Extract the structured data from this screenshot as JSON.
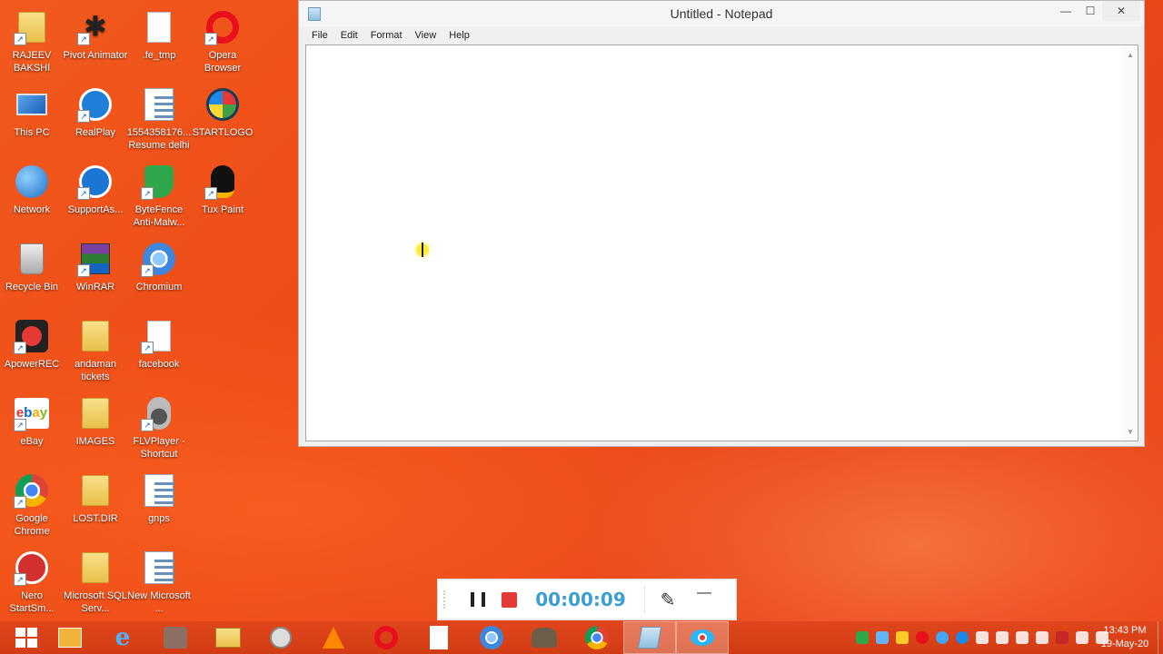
{
  "desktop": {
    "icons": [
      {
        "label": "RAJEEV BAKSHI",
        "icon": "folder-icon"
      },
      {
        "label": "Pivot Animator",
        "icon": "stick-figure-icon"
      },
      {
        "label": ".fe_tmp",
        "icon": "file-icon"
      },
      {
        "label": "Opera Browser",
        "icon": "opera-icon"
      },
      {
        "label": "This PC",
        "icon": "computer-icon"
      },
      {
        "label": "RealPlay",
        "icon": "realplay-icon"
      },
      {
        "label": "1554358176... Resume delhi",
        "icon": "word-document-icon"
      },
      {
        "label": "STARTLOGO",
        "icon": "windows-logo-icon"
      },
      {
        "label": "Network",
        "icon": "network-globe-icon"
      },
      {
        "label": "SupportAs...",
        "icon": "support-assistant-icon"
      },
      {
        "label": "ByteFence Anti-Malw...",
        "icon": "shield-icon"
      },
      {
        "label": "Tux Paint",
        "icon": "penguin-icon"
      },
      {
        "label": "Recycle Bin",
        "icon": "recycle-bin-icon"
      },
      {
        "label": "WinRAR",
        "icon": "winrar-icon"
      },
      {
        "label": "Chromium",
        "icon": "chromium-icon"
      },
      {
        "label": "ApowerREC",
        "icon": "record-icon"
      },
      {
        "label": "andaman tickets",
        "icon": "folder-icon"
      },
      {
        "label": "facebook",
        "icon": "file-icon"
      },
      {
        "label": "eBay",
        "icon": "ebay-icon"
      },
      {
        "label": "IMAGES",
        "icon": "folder-icon"
      },
      {
        "label": "FLVPlayer - Shortcut",
        "icon": "speaker-icon"
      },
      {
        "label": "Google Chrome",
        "icon": "chrome-icon"
      },
      {
        "label": "LOST.DIR",
        "icon": "folder-icon"
      },
      {
        "label": "gnps",
        "icon": "word-document-icon"
      },
      {
        "label": "Nero StartSm...",
        "icon": "nero-icon"
      },
      {
        "label": "Microsoft SQL Serv...",
        "icon": "folder-icon"
      },
      {
        "label": "New Microsoft ...",
        "icon": "word-document-icon"
      }
    ]
  },
  "notepad": {
    "title": "Untitled - Notepad",
    "menu": [
      "File",
      "Edit",
      "Format",
      "View",
      "Help"
    ],
    "content": "",
    "controls": {
      "minimize": "—",
      "maximize": "☐",
      "close": "✕"
    }
  },
  "recorder": {
    "time": "00:00:09",
    "minimize": "—"
  },
  "taskbar": {
    "apps": [
      "file-explorer-icon",
      "internet-explorer-icon",
      "fl-studio-icon",
      "folder-window-icon",
      "pivot-icon",
      "vlc-icon",
      "opera-icon",
      "document-icon",
      "chromium-icon",
      "gimp-icon",
      "chrome-icon",
      "notepad-icon",
      "apowerrec-icon"
    ],
    "clock_time": "13:43 PM",
    "clock_date": "19-May-20"
  }
}
